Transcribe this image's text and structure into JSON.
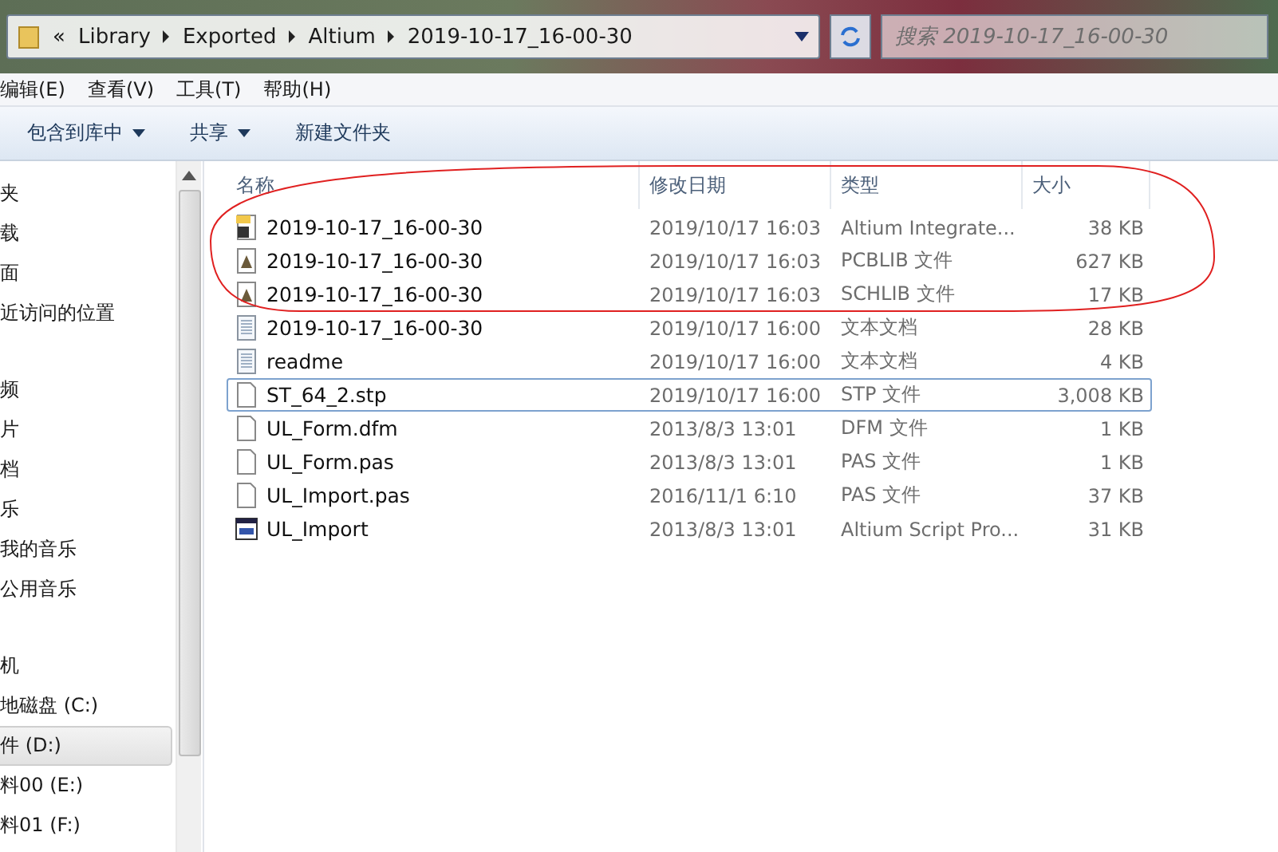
{
  "address_bar": {
    "overflow": "«",
    "crumbs": [
      "Library",
      "Exported",
      "Altium",
      "2019-10-17_16-00-30"
    ]
  },
  "search": {
    "placeholder": "搜索 2019-10-17_16-00-30"
  },
  "menu": [
    "编辑(E)",
    "查看(V)",
    "工具(T)",
    "帮助(H)"
  ],
  "toolbar": [
    {
      "label": "包含到库中",
      "dropdown": true
    },
    {
      "label": "共享",
      "dropdown": true
    },
    {
      "label": "新建文件夹",
      "dropdown": false
    }
  ],
  "sidebar": {
    "items": [
      {
        "label": "夹",
        "selected": false
      },
      {
        "label": "载",
        "selected": false
      },
      {
        "label": "面",
        "selected": false
      },
      {
        "label": "近访问的位置",
        "selected": false
      },
      {
        "label": "频",
        "selected": false
      },
      {
        "label": "片",
        "selected": false
      },
      {
        "label": "档",
        "selected": false
      },
      {
        "label": "乐",
        "selected": false
      },
      {
        "label": "我的音乐",
        "selected": false
      },
      {
        "label": "公用音乐",
        "selected": false
      },
      {
        "label": "机",
        "selected": false
      },
      {
        "label": "地磁盘 (C:)",
        "selected": false
      },
      {
        "label": "件 (D:)",
        "selected": true
      },
      {
        "label": "料00 (E:)",
        "selected": false
      },
      {
        "label": "料01 (F:)",
        "selected": false
      }
    ]
  },
  "table": {
    "columns": [
      "名称",
      "修改日期",
      "类型",
      "大小"
    ],
    "rows": [
      {
        "kind": "integrated",
        "name": "2019-10-17_16-00-30",
        "date": "2019/10/17 16:03",
        "type": "Altium Integrate...",
        "size": "38 KB",
        "focused": false
      },
      {
        "kind": "altium",
        "name": "2019-10-17_16-00-30",
        "date": "2019/10/17 16:03",
        "type": "PCBLIB 文件",
        "size": "627 KB",
        "focused": false
      },
      {
        "kind": "altium",
        "name": "2019-10-17_16-00-30",
        "date": "2019/10/17 16:03",
        "type": "SCHLIB 文件",
        "size": "17 KB",
        "focused": false
      },
      {
        "kind": "text",
        "name": "2019-10-17_16-00-30",
        "date": "2019/10/17 16:00",
        "type": "文本文档",
        "size": "28 KB",
        "focused": false
      },
      {
        "kind": "text",
        "name": "readme",
        "date": "2019/10/17 16:00",
        "type": "文本文档",
        "size": "4 KB",
        "focused": false
      },
      {
        "kind": "blank",
        "name": "ST_64_2.stp",
        "date": "2019/10/17 16:00",
        "type": "STP 文件",
        "size": "3,008 KB",
        "focused": true
      },
      {
        "kind": "blank",
        "name": "UL_Form.dfm",
        "date": "2013/8/3 13:01",
        "type": "DFM 文件",
        "size": "1 KB",
        "focused": false
      },
      {
        "kind": "blank",
        "name": "UL_Form.pas",
        "date": "2013/8/3 13:01",
        "type": "PAS 文件",
        "size": "1 KB",
        "focused": false
      },
      {
        "kind": "blank",
        "name": "UL_Import.pas",
        "date": "2016/11/1 6:10",
        "type": "PAS 文件",
        "size": "37 KB",
        "focused": false
      },
      {
        "kind": "script",
        "name": "UL_Import",
        "date": "2013/8/3 13:01",
        "type": "Altium Script Pro...",
        "size": "31 KB",
        "focused": false
      }
    ]
  }
}
